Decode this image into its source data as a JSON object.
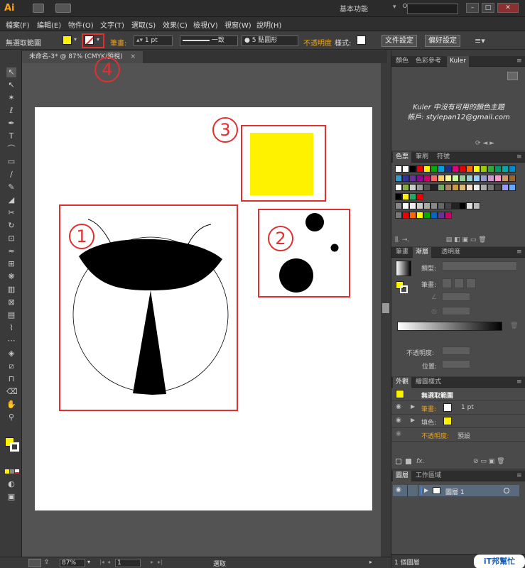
{
  "app": {
    "logo": "Ai",
    "workspace": "基本功能",
    "search_placeholder": ""
  },
  "window_controls": {
    "minimize": "–",
    "restore": "□",
    "close": "✕"
  },
  "menu": [
    "檔案(F)",
    "編輯(E)",
    "物件(O)",
    "文字(T)",
    "選取(S)",
    "效果(C)",
    "檢視(V)",
    "視窗(W)",
    "說明(H)"
  ],
  "control": {
    "selection": "無選取範圍",
    "stroke_label": "筆畫:",
    "stroke_weight": "1 pt",
    "stroke_profile": "一致",
    "brush": "5 點圓形",
    "opacity_label": "不透明度",
    "style_label": "樣式:",
    "doc_setup": "文件設定",
    "prefs": "偏好設定"
  },
  "document_tab": {
    "title": "未命名-3* @ 87% (CMYK/預視)",
    "close": "×"
  },
  "annotations": [
    "1",
    "2",
    "3",
    "4"
  ],
  "status": {
    "zoom": "87%",
    "page": "1",
    "tool": "選取"
  },
  "kuler": {
    "tabs": [
      "顏色",
      "色彩參考",
      "Kuler"
    ],
    "message": "Kuler 中沒有可用的顏色主題",
    "account": "帳戶: stylepan12@gmail.com"
  },
  "swatches_panel": {
    "tabs": [
      "色票",
      "筆刷",
      "符號"
    ]
  },
  "gradient_panel": {
    "tabs": [
      "筆畫",
      "漸層",
      "透明度"
    ],
    "type_label": "類型:",
    "stroke_label": "筆畫:",
    "opacity_label": "不透明度:",
    "position_label": "位置:"
  },
  "appearance_panel": {
    "tabs": [
      "外觀",
      "繪圖樣式"
    ],
    "title": "無選取範圍",
    "stroke_label": "筆畫:",
    "stroke_value": "1 pt",
    "fill_label": "填色:",
    "opacity_label": "不透明度:",
    "opacity_value": "預設",
    "fx": "fx."
  },
  "layers_panel": {
    "tabs": [
      "圖層",
      "工作區域"
    ],
    "layer_name": "圖層 1",
    "count": "1 個圖層"
  },
  "watermark": "iT邦幫忙",
  "colors": {
    "accent_yellow": "#fff200",
    "annotation_red": "#e03030",
    "ui_orange": "#e8a020"
  }
}
